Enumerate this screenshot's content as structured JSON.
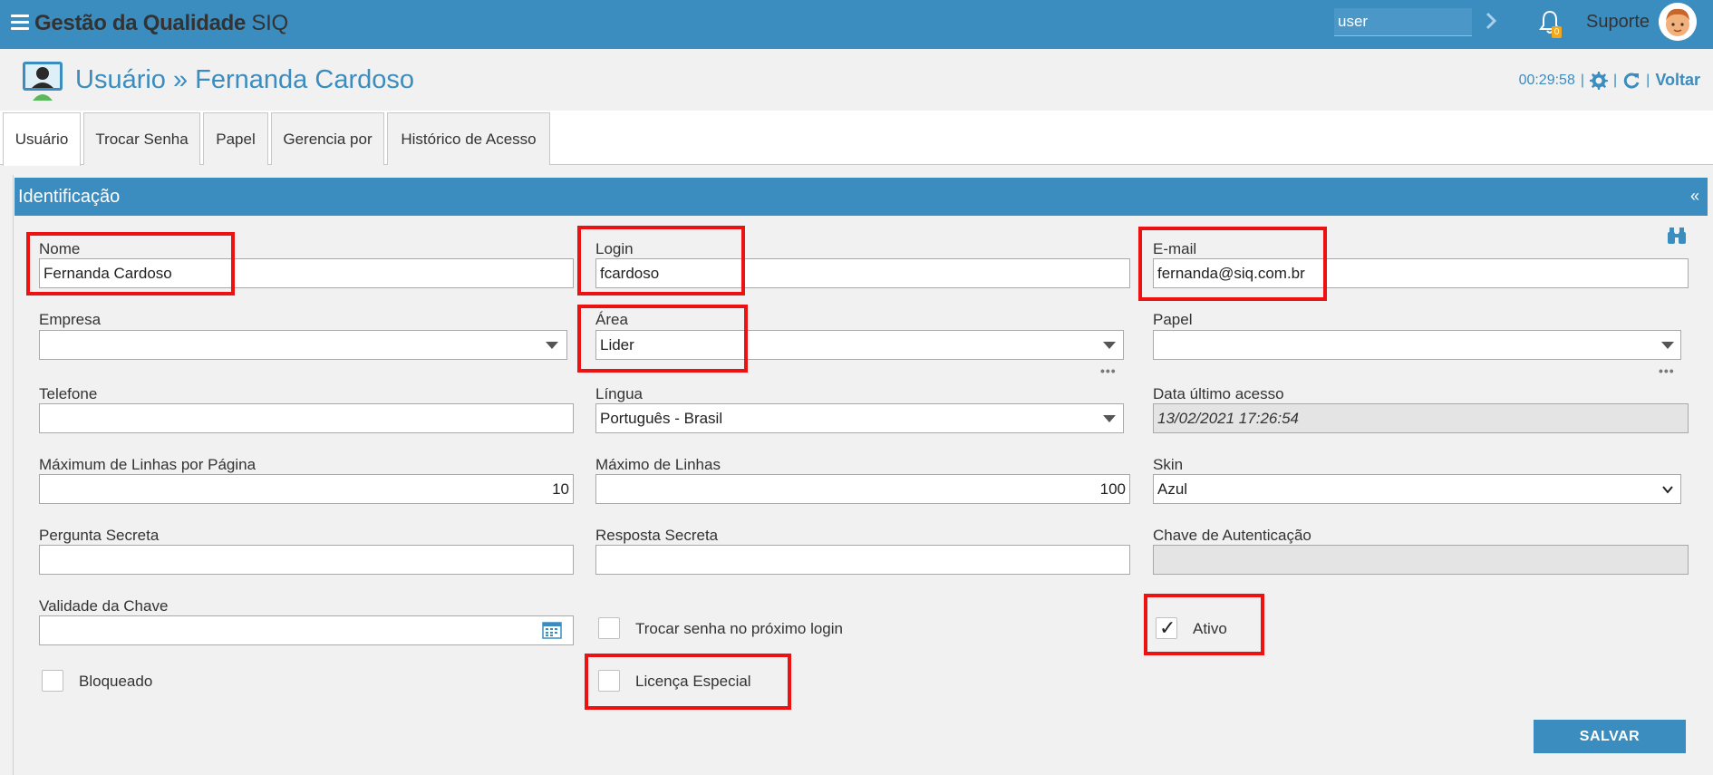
{
  "app": {
    "title": "Gestão da Qualidade",
    "title_suffix": "SIQ"
  },
  "topbar": {
    "search_value": "user",
    "notification_count": "0",
    "user_name": "Suporte"
  },
  "page": {
    "title": "Usuário » Fernanda Cardoso",
    "timer": "00:29:58",
    "back_label": "Voltar"
  },
  "tabs": [
    {
      "label": "Usuário",
      "active": true
    },
    {
      "label": "Trocar Senha"
    },
    {
      "label": "Papel"
    },
    {
      "label": "Gerencia por"
    },
    {
      "label": "Histórico de Acesso"
    }
  ],
  "panel": {
    "title": "Identificação",
    "collapse_glyph": "«"
  },
  "form": {
    "nome": {
      "label": "Nome",
      "value": "Fernanda Cardoso"
    },
    "login": {
      "label": "Login",
      "value": "fcardoso"
    },
    "email": {
      "label": "E-mail",
      "value": "fernanda@siq.com.br"
    },
    "empresa": {
      "label": "Empresa",
      "value": ""
    },
    "area": {
      "label": "Área",
      "value": "Lider"
    },
    "papel": {
      "label": "Papel",
      "value": ""
    },
    "telefone": {
      "label": "Telefone",
      "value": ""
    },
    "lingua": {
      "label": "Língua",
      "value": "Português - Brasil"
    },
    "data_ultimo_acesso": {
      "label": "Data último acesso",
      "value": "13/02/2021 17:26:54"
    },
    "max_linhas_pagina": {
      "label": "Máximum de Linhas por Página",
      "value": "10"
    },
    "max_linhas": {
      "label": "Máximo de Linhas",
      "value": "100"
    },
    "skin": {
      "label": "Skin",
      "value": "Azul"
    },
    "pergunta_secreta": {
      "label": "Pergunta Secreta",
      "value": ""
    },
    "resposta_secreta": {
      "label": "Resposta Secreta",
      "value": ""
    },
    "chave_autenticacao": {
      "label": "Chave de Autenticação",
      "value": ""
    },
    "validade_chave": {
      "label": "Validade da Chave",
      "value": ""
    },
    "trocar_senha": {
      "label": "Trocar senha no próximo login",
      "checked": false
    },
    "ativo": {
      "label": "Ativo",
      "checked": true,
      "tick": "✓"
    },
    "bloqueado": {
      "label": "Bloqueado",
      "checked": false
    },
    "licenca_especial": {
      "label": "Licença Especial",
      "checked": false
    },
    "lookup_dots": "•••"
  },
  "buttons": {
    "save": "SALVAR"
  },
  "colors": {
    "primary": "#3b8cbf",
    "highlight": "#ee1111",
    "badge": "#f0a820"
  }
}
